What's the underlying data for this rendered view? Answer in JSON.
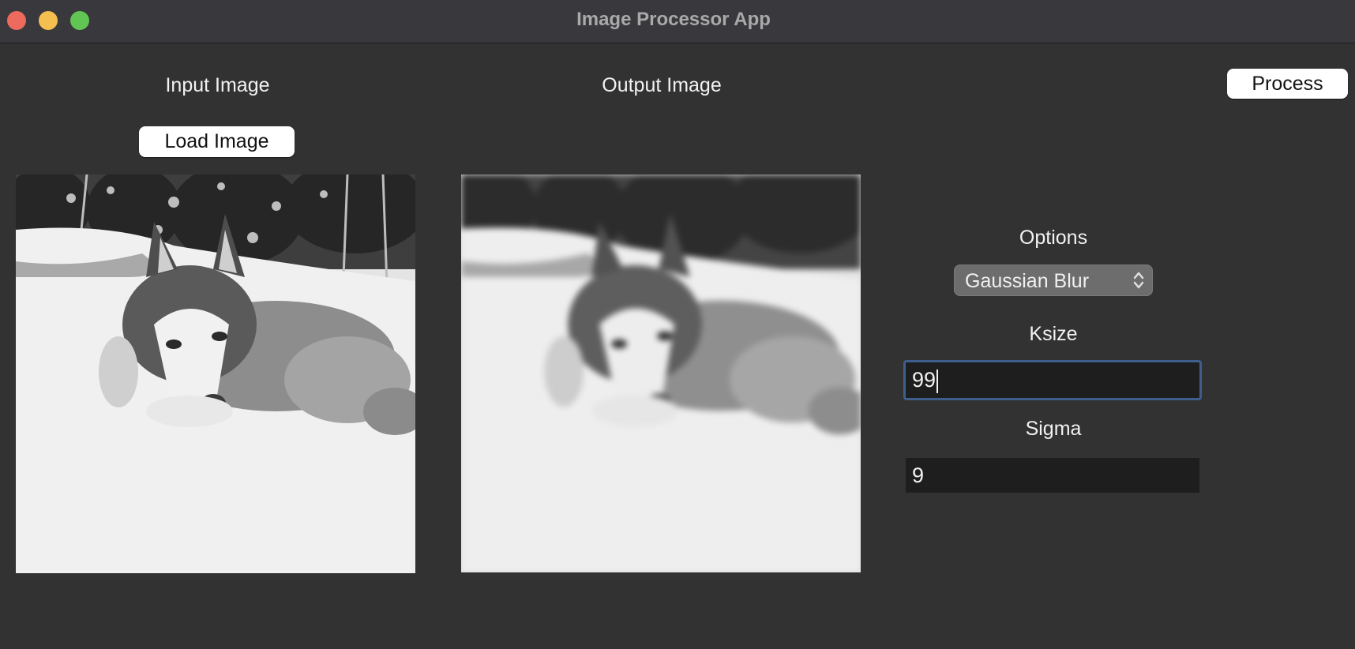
{
  "window": {
    "title": "Image Processor App"
  },
  "input_panel": {
    "heading": "Input Image",
    "load_button_label": "Load Image"
  },
  "output_panel": {
    "heading": "Output Image"
  },
  "controls": {
    "process_button_label": "Process",
    "options_label": "Options",
    "options_selected": "Gaussian Blur",
    "ksize_label": "Ksize",
    "ksize_value": "99",
    "sigma_label": "Sigma",
    "sigma_value": "9"
  },
  "colors": {
    "window_background": "#323232",
    "titlebar": "#39383c",
    "close": "#ec6a5e",
    "minimize": "#f4bf4f",
    "maximize": "#61c554",
    "focus_ring": "#3e5f8d"
  }
}
